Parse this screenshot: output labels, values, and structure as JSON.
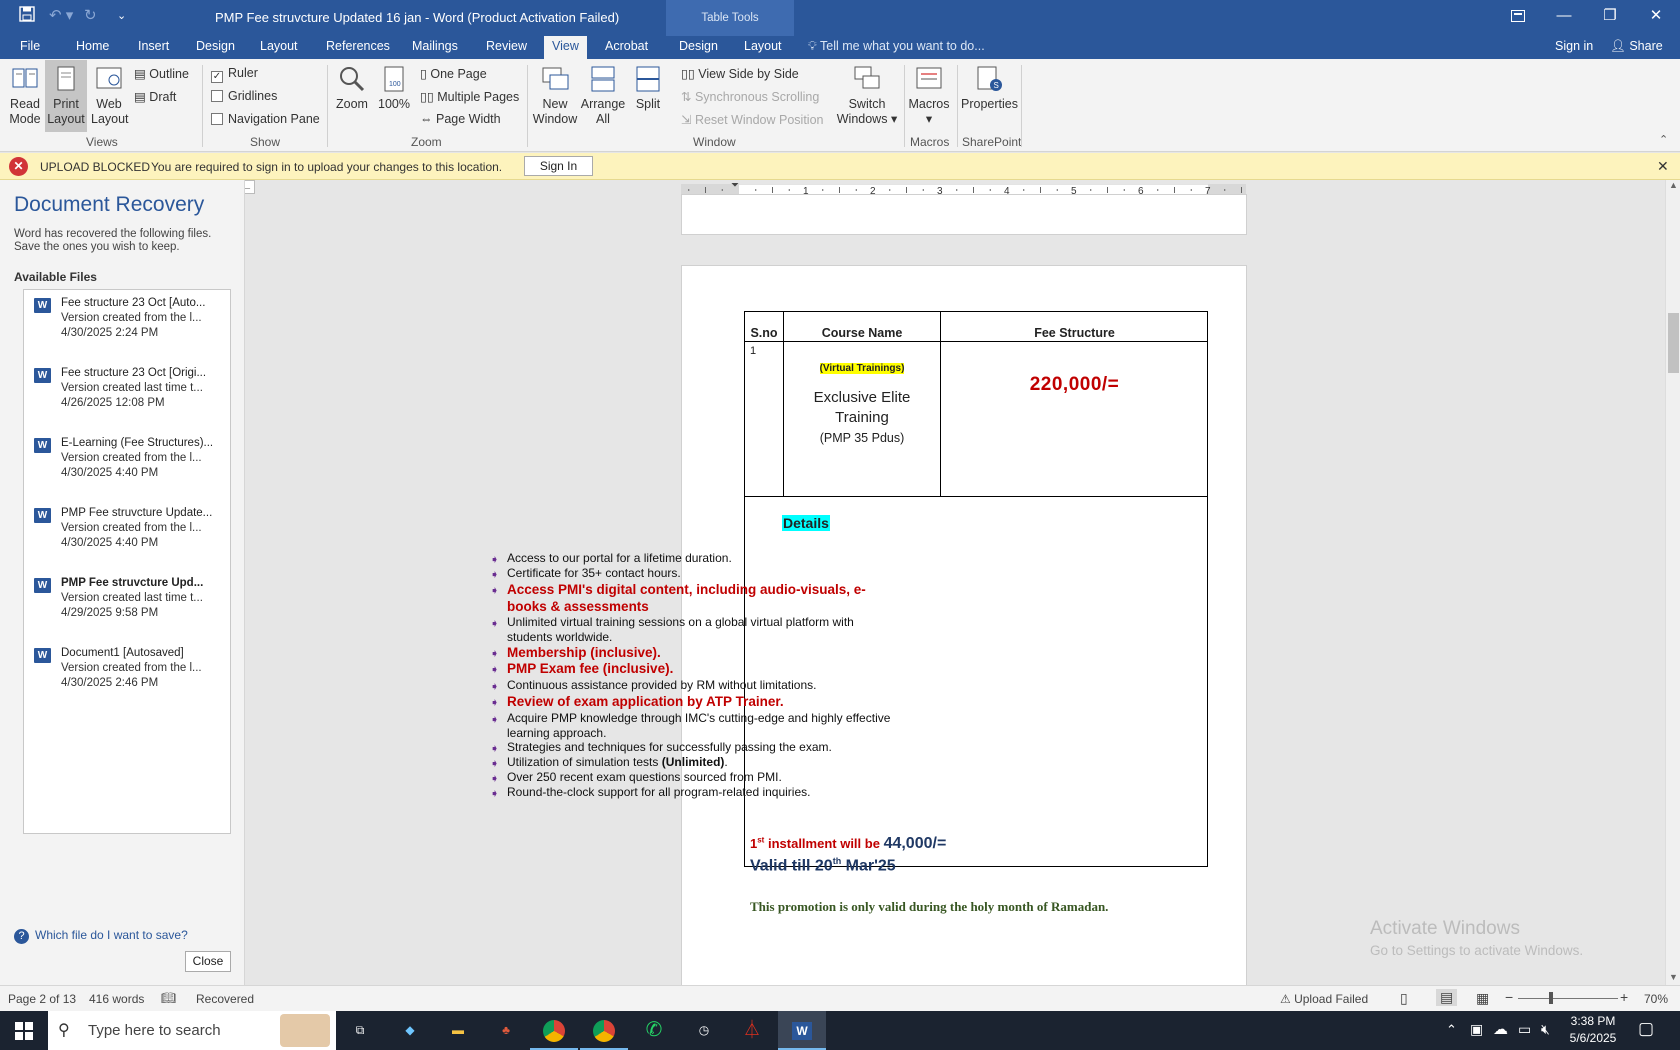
{
  "window": {
    "title": "PMP Fee struvcture Updated 16 jan - Word (Product Activation Failed)",
    "table_tools": "Table Tools"
  },
  "tabs": [
    "File",
    "Home",
    "Insert",
    "Design",
    "Layout",
    "References",
    "Mailings",
    "Review",
    "View",
    "Acrobat",
    "Design",
    "Layout"
  ],
  "tell_me": "Tell me what you want to do...",
  "sign_in": "Sign in",
  "share": "Share",
  "ribbon": {
    "views": {
      "read_mode": "Read Mode",
      "print_layout": "Print Layout",
      "web_layout": "Web Layout",
      "outline": "Outline",
      "draft": "Draft",
      "group": "Views"
    },
    "show": {
      "ruler": "Ruler",
      "gridlines": "Gridlines",
      "navigation_pane": "Navigation Pane",
      "group": "Show"
    },
    "zoom": {
      "zoom": "Zoom",
      "hundred": "100%",
      "one_page": "One Page",
      "multiple_pages": "Multiple Pages",
      "page_width": "Page Width",
      "group": "Zoom"
    },
    "window": {
      "new_window": "New Window",
      "arrange_all": "Arrange All",
      "split": "Split",
      "side_by_side": "View Side by Side",
      "sync_scroll": "Synchronous Scrolling",
      "reset_pos": "Reset Window Position",
      "switch_windows": "Switch Windows",
      "group": "Window"
    },
    "macros": {
      "macros": "Macros",
      "group": "Macros"
    },
    "sharepoint": {
      "properties": "Properties",
      "group": "SharePoint"
    }
  },
  "message_bar": {
    "title": "UPLOAD BLOCKED",
    "text": "You are required to sign in to upload your changes to this location.",
    "button": "Sign In"
  },
  "recovery": {
    "title": "Document Recovery",
    "desc1": "Word has recovered the following files.",
    "desc2": "Save the ones you wish to keep.",
    "available": "Available Files",
    "files": [
      {
        "name": "Fee structure 23 Oct  [Auto...",
        "line1": "Version created from the l...",
        "line2": "4/30/2025 2:24 PM",
        "bold": false
      },
      {
        "name": "Fee structure 23 Oct  [Origi...",
        "line1": "Version created last time t...",
        "line2": "4/26/2025 12:08 PM",
        "bold": false
      },
      {
        "name": "E-Learning (Fee Structures)...",
        "line1": "Version created from the l...",
        "line2": "4/30/2025 4:40 PM",
        "bold": false
      },
      {
        "name": "PMP Fee struvcture Update...",
        "line1": "Version created from the l...",
        "line2": "4/30/2025 4:40 PM",
        "bold": false
      },
      {
        "name": "PMP Fee struvcture Upd...",
        "line1": "Version created last time t...",
        "line2": "4/29/2025 9:58 PM",
        "bold": true
      },
      {
        "name": "Document1  [Autosaved]",
        "line1": "Version created from the l...",
        "line2": "4/30/2025 2:46 PM",
        "bold": false
      }
    ],
    "help": "Which file do I want to save?",
    "close": "Close"
  },
  "ruler_numbers": [
    "1",
    "2",
    "3",
    "4",
    "5",
    "6",
    "7"
  ],
  "doc": {
    "h_sno": "S.no",
    "h_course": "Course Name",
    "h_fee": "Fee Structure",
    "row_no": "1",
    "virtual": "(Virtual Trainings)",
    "course1": "Exclusive Elite",
    "course2": "Training",
    "course3": "(PMP 35 Pdus)",
    "fee": "220,000/=",
    "details": "Details",
    "bullets": [
      {
        "text": "Access to our portal for a lifetime duration.",
        "red": false
      },
      {
        "text": "Certificate for 35+ contact hours.",
        "red": false
      },
      {
        "text": "Access PMI's digital content, including audio-visuals, e-books & assessments",
        "red": true
      },
      {
        "text": "Unlimited virtual training sessions on a global virtual platform with students worldwide.",
        "red": false
      },
      {
        "text": "Membership (inclusive).",
        "red": true
      },
      {
        "text": "PMP Exam fee (inclusive).",
        "red": true
      },
      {
        "text": "Continuous assistance provided by RM without limitations.",
        "red": false
      },
      {
        "text": " Review of exam application by ATP Trainer.",
        "red": true
      },
      {
        "text": "Acquire PMP knowledge through IMC's cutting-edge and highly effective learning approach.",
        "red": false
      },
      {
        "text": "Strategies and techniques for successfully passing the exam.",
        "red": false
      },
      {
        "text": "Utilization of simulation tests",
        "red": false,
        "bold_suffix": "(Unlimited)",
        "suffix": "."
      },
      {
        "text": "Over 250 recent exam questions sourced from PMI.",
        "red": false
      },
      {
        "text": "Round-the-clock support for all program-related inquiries.",
        "red": false
      }
    ],
    "inst_1": "1",
    "inst_sup": "st",
    "inst_rest": " installment will be ",
    "inst_amount": "44,000/=",
    "valid_pre": "Valid till 20",
    "valid_sup": "th",
    "valid_post": " Mar'25",
    "promo": "This promotion is only valid during the holy month of Ramadan."
  },
  "watermark": {
    "line1": "Activate Windows",
    "line2": "Go to Settings to activate Windows."
  },
  "status": {
    "page": "Page 2 of 13",
    "words": "416 words",
    "recovered": "Recovered",
    "upload": "Upload Failed",
    "zoom": "70%"
  },
  "taskbar": {
    "search": "Type here to search",
    "time": "3:38 PM",
    "date": "5/6/2025"
  }
}
